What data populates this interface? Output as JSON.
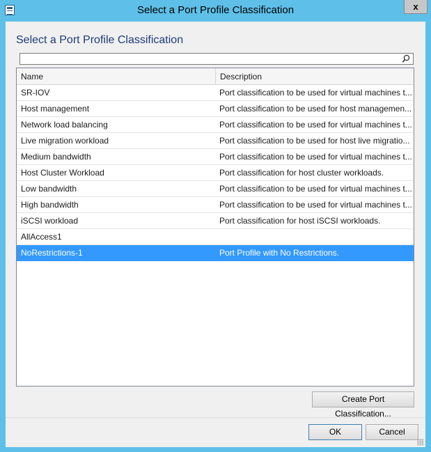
{
  "window": {
    "title": "Select a Port Profile Classification",
    "close_glyph": "x"
  },
  "dialog": {
    "heading": "Select a Port Profile Classification",
    "search": {
      "value": "",
      "placeholder": "",
      "icon": "search-icon"
    }
  },
  "list": {
    "columns": [
      "Name",
      "Description"
    ],
    "rows": [
      {
        "name": "SR-IOV",
        "description": "Port classification to be used for virtual machines t..."
      },
      {
        "name": "Host management",
        "description": "Port classification to be used for host managemen..."
      },
      {
        "name": "Network load balancing",
        "description": "Port classification to be used for virtual machines t..."
      },
      {
        "name": "Live migration  workload",
        "description": "Port classification to be used for host live migratio..."
      },
      {
        "name": "Medium bandwidth",
        "description": "Port classification to be used for virtual machines t..."
      },
      {
        "name": "Host Cluster Workload",
        "description": "Port classification for host cluster workloads."
      },
      {
        "name": "Low bandwidth",
        "description": "Port classification to be used for virtual machines t..."
      },
      {
        "name": "High bandwidth",
        "description": "Port classification to be used for virtual machines t..."
      },
      {
        "name": "iSCSI workload",
        "description": "Port classification for host iSCSI workloads."
      },
      {
        "name": "AllAccess1",
        "description": ""
      },
      {
        "name": "NoRestrictions-1",
        "description": "Port Profile with No Restrictions.",
        "selected": true
      }
    ]
  },
  "buttons": {
    "create": "Create Port Classification...",
    "ok": "OK",
    "cancel": "Cancel"
  },
  "colors": {
    "titlebar": "#5ec0e8",
    "selection": "#3399ff",
    "heading": "#1e3c78"
  }
}
